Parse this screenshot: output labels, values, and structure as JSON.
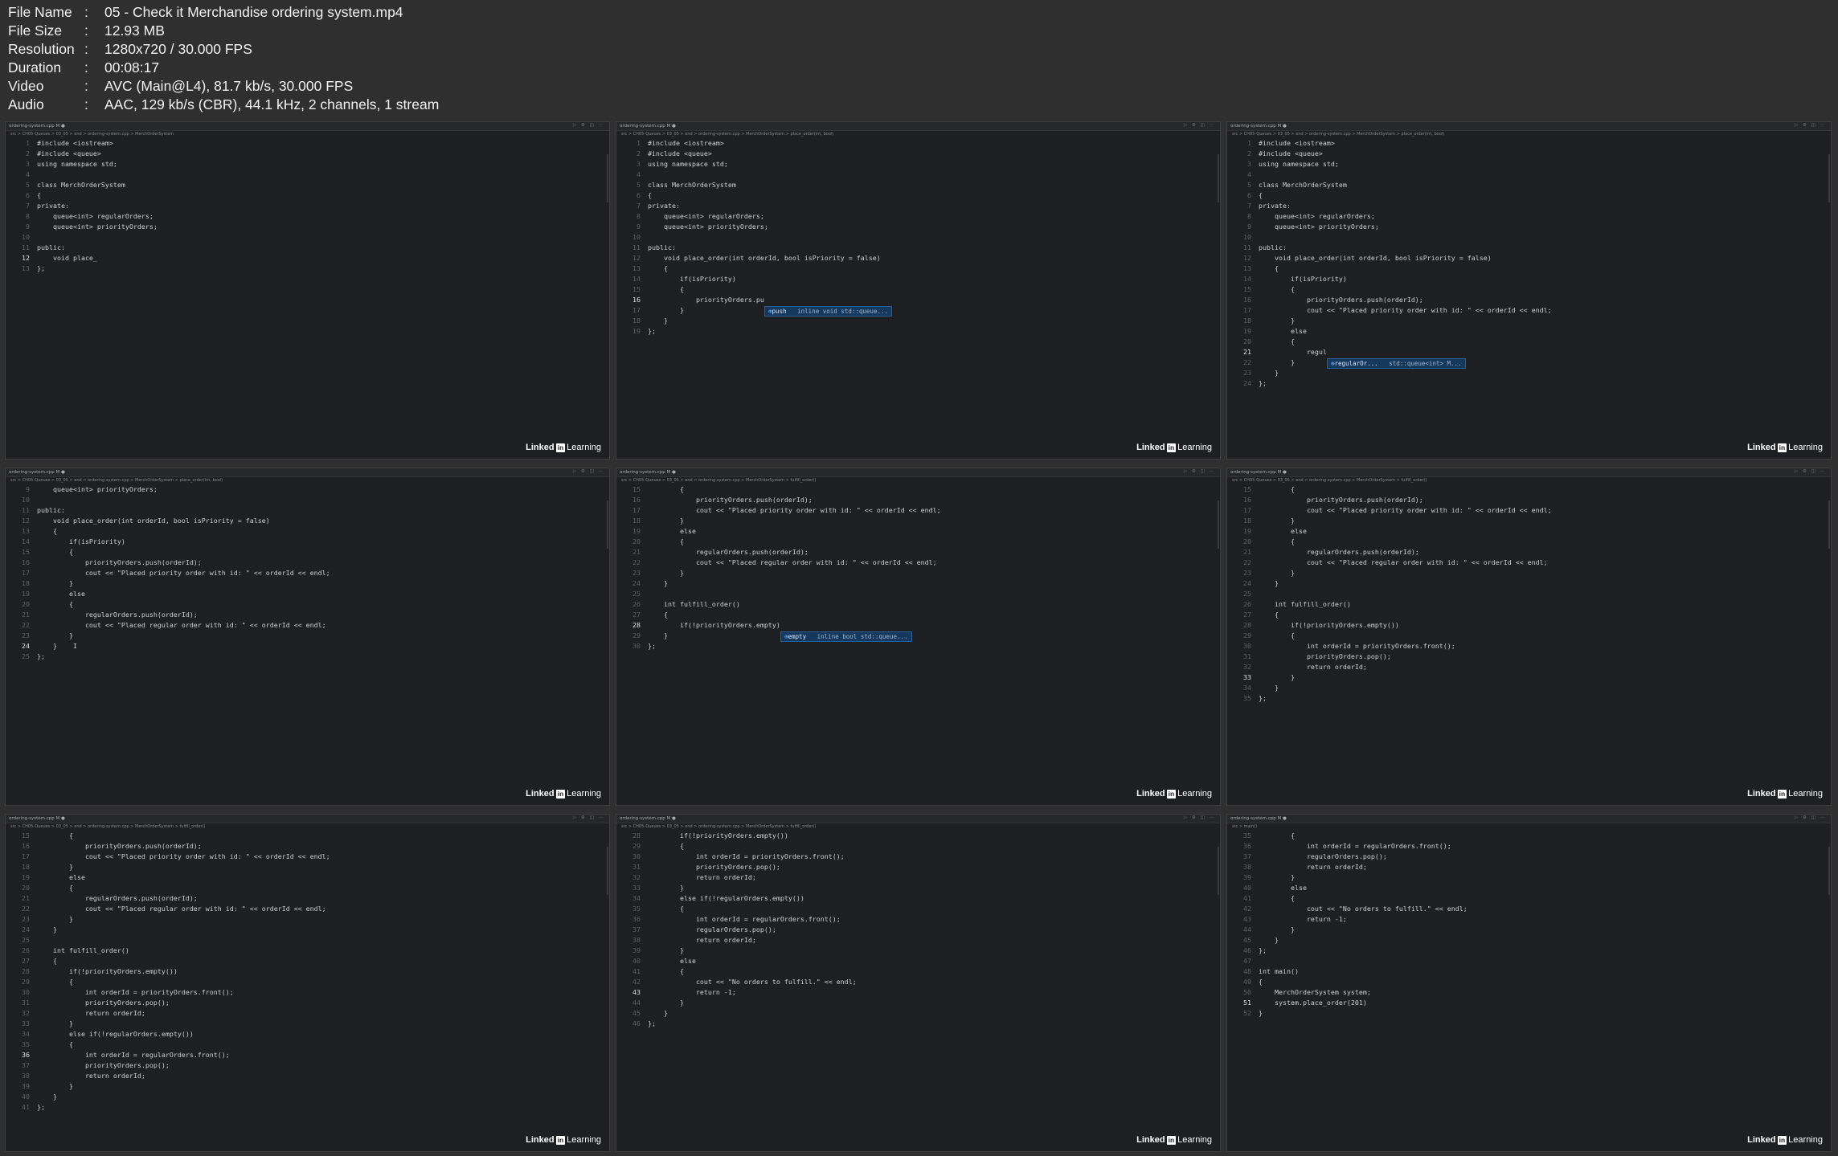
{
  "meta": [
    {
      "key": "File Name",
      "value": "05 - Check it Merchandise ordering system.mp4"
    },
    {
      "key": "File Size",
      "value": "12.93 MB"
    },
    {
      "key": "Resolution",
      "value": "1280x720 / 30.000 FPS"
    },
    {
      "key": "Duration",
      "value": "00:08:17"
    },
    {
      "key": "Video",
      "value": "AVC (Main@L4), 81.7 kb/s, 30.000 FPS"
    },
    {
      "key": "Audio",
      "value": "AAC, 129 kb/s (CBR), 44.1 kHz, 2 channels, 1 stream"
    }
  ],
  "watermark": {
    "brand": "Linked",
    "logo": "in",
    "product": "Learning"
  },
  "frames": [
    {
      "tab": "ordering-system.cpp M ●",
      "crumb": "src > CH05-Queues > 03_05 > end > ordering-system.cpp > MerchOrderSystem",
      "cursor_line": "12",
      "lines": [
        {
          "n": "1",
          "t": "#include <iostream>"
        },
        {
          "n": "2",
          "t": "#include <queue>"
        },
        {
          "n": "3",
          "t": "using namespace std;"
        },
        {
          "n": "4",
          "t": ""
        },
        {
          "n": "5",
          "t": "class MerchOrderSystem"
        },
        {
          "n": "6",
          "t": "{"
        },
        {
          "n": "7",
          "t": "private:"
        },
        {
          "n": "8",
          "t": "    queue<int> regularOrders;"
        },
        {
          "n": "9",
          "t": "    queue<int> priorityOrders;"
        },
        {
          "n": "10",
          "t": ""
        },
        {
          "n": "11",
          "t": "public:"
        },
        {
          "n": "12",
          "t": "    void place_"
        },
        {
          "n": "13",
          "t": "};"
        }
      ]
    },
    {
      "tab": "ordering-system.cpp M ●",
      "crumb": "src > CH05-Queues > 03_05 > end > ordering-system.cpp > MerchOrderSystem > place_order(int, bool)",
      "cursor_line": "16",
      "autocomplete": {
        "label": "push",
        "detail": "inline void std::queue..."
      },
      "lines": [
        {
          "n": "1",
          "t": "#include <iostream>"
        },
        {
          "n": "2",
          "t": "#include <queue>"
        },
        {
          "n": "3",
          "t": "using namespace std;"
        },
        {
          "n": "4",
          "t": ""
        },
        {
          "n": "5",
          "t": "class MerchOrderSystem"
        },
        {
          "n": "6",
          "t": "{"
        },
        {
          "n": "7",
          "t": "private:"
        },
        {
          "n": "8",
          "t": "    queue<int> regularOrders;"
        },
        {
          "n": "9",
          "t": "    queue<int> priorityOrders;"
        },
        {
          "n": "10",
          "t": ""
        },
        {
          "n": "11",
          "t": "public:"
        },
        {
          "n": "12",
          "t": "    void place_order(int orderId, bool isPriority = false)"
        },
        {
          "n": "13",
          "t": "    {"
        },
        {
          "n": "14",
          "t": "        if(isPriority)"
        },
        {
          "n": "15",
          "t": "        {"
        },
        {
          "n": "16",
          "t": "            priorityOrders.pu"
        },
        {
          "n": "17",
          "t": "        }"
        },
        {
          "n": "18",
          "t": "    }"
        },
        {
          "n": "19",
          "t": "};"
        }
      ]
    },
    {
      "tab": "ordering-system.cpp M ●",
      "crumb": "src > CH05-Queues > 03_05 > end > ordering-system.cpp > MerchOrderSystem > place_order(int, bool)",
      "cursor_line": "21",
      "autocomplete": {
        "label": "regularOr...",
        "detail": "std::queue<int> M..."
      },
      "lines": [
        {
          "n": "1",
          "t": "#include <iostream>"
        },
        {
          "n": "2",
          "t": "#include <queue>"
        },
        {
          "n": "3",
          "t": "using namespace std;"
        },
        {
          "n": "4",
          "t": ""
        },
        {
          "n": "5",
          "t": "class MerchOrderSystem"
        },
        {
          "n": "6",
          "t": "{"
        },
        {
          "n": "7",
          "t": "private:"
        },
        {
          "n": "8",
          "t": "    queue<int> regularOrders;"
        },
        {
          "n": "9",
          "t": "    queue<int> priorityOrders;"
        },
        {
          "n": "10",
          "t": ""
        },
        {
          "n": "11",
          "t": "public:"
        },
        {
          "n": "12",
          "t": "    void place_order(int orderId, bool isPriority = false)"
        },
        {
          "n": "13",
          "t": "    {"
        },
        {
          "n": "14",
          "t": "        if(isPriority)"
        },
        {
          "n": "15",
          "t": "        {"
        },
        {
          "n": "16",
          "t": "            priorityOrders.push(orderId);"
        },
        {
          "n": "17",
          "t": "            cout << \"Placed priority order with id: \" << orderId << endl;"
        },
        {
          "n": "18",
          "t": "        }"
        },
        {
          "n": "19",
          "t": "        else"
        },
        {
          "n": "20",
          "t": "        {"
        },
        {
          "n": "21",
          "t": "            regul"
        },
        {
          "n": "22",
          "t": "        }"
        },
        {
          "n": "23",
          "t": "    }"
        },
        {
          "n": "24",
          "t": "};"
        }
      ]
    },
    {
      "tab": "ordering-system.cpp M ●",
      "crumb": "src > CH05-Queues > 03_05 > end > ordering-system.cpp > MerchOrderSystem > place_order(int, bool)",
      "cursor_line": "24",
      "lines": [
        {
          "n": "9",
          "t": "    queue<int> priorityOrders;"
        },
        {
          "n": "10",
          "t": ""
        },
        {
          "n": "11",
          "t": "public:"
        },
        {
          "n": "12",
          "t": "    void place_order(int orderId, bool isPriority = false)"
        },
        {
          "n": "13",
          "t": "    {"
        },
        {
          "n": "14",
          "t": "        if(isPriority)"
        },
        {
          "n": "15",
          "t": "        {"
        },
        {
          "n": "16",
          "t": "            priorityOrders.push(orderId);"
        },
        {
          "n": "17",
          "t": "            cout << \"Placed priority order with id: \" << orderId << endl;"
        },
        {
          "n": "18",
          "t": "        }"
        },
        {
          "n": "19",
          "t": "        else"
        },
        {
          "n": "20",
          "t": "        {"
        },
        {
          "n": "21",
          "t": "            regularOrders.push(orderId);"
        },
        {
          "n": "22",
          "t": "            cout << \"Placed regular order with id: \" << orderId << endl;"
        },
        {
          "n": "23",
          "t": "        }"
        },
        {
          "n": "24",
          "t": "    }    I"
        },
        {
          "n": "25",
          "t": "};"
        }
      ]
    },
    {
      "tab": "ordering-system.cpp M ●",
      "crumb": "src > CH05-Queues > 03_05 > end > ordering-system.cpp > MerchOrderSystem > fulfill_order()",
      "cursor_line": "28",
      "autocomplete": {
        "label": "empty",
        "detail": "inline bool std::queue..."
      },
      "lines": [
        {
          "n": "15",
          "t": "        {"
        },
        {
          "n": "16",
          "t": "            priorityOrders.push(orderId);"
        },
        {
          "n": "17",
          "t": "            cout << \"Placed priority order with id: \" << orderId << endl;"
        },
        {
          "n": "18",
          "t": "        }"
        },
        {
          "n": "19",
          "t": "        else"
        },
        {
          "n": "20",
          "t": "        {"
        },
        {
          "n": "21",
          "t": "            regularOrders.push(orderId);"
        },
        {
          "n": "22",
          "t": "            cout << \"Placed regular order with id: \" << orderId << endl;"
        },
        {
          "n": "23",
          "t": "        }"
        },
        {
          "n": "24",
          "t": "    }"
        },
        {
          "n": "25",
          "t": ""
        },
        {
          "n": "26",
          "t": "    int fulfill_order()"
        },
        {
          "n": "27",
          "t": "    {"
        },
        {
          "n": "28",
          "t": "        if(!priorityOrders.empty)"
        },
        {
          "n": "29",
          "t": "    }"
        },
        {
          "n": "30",
          "t": "};"
        }
      ]
    },
    {
      "tab": "ordering-system.cpp M ●",
      "crumb": "src > CH05-Queues > 03_05 > end > ordering-system.cpp > MerchOrderSystem > fulfill_order()",
      "cursor_line": "33",
      "lines": [
        {
          "n": "15",
          "t": "        {"
        },
        {
          "n": "16",
          "t": "            priorityOrders.push(orderId);"
        },
        {
          "n": "17",
          "t": "            cout << \"Placed priority order with id: \" << orderId << endl;"
        },
        {
          "n": "18",
          "t": "        }"
        },
        {
          "n": "19",
          "t": "        else"
        },
        {
          "n": "20",
          "t": "        {"
        },
        {
          "n": "21",
          "t": "            regularOrders.push(orderId);"
        },
        {
          "n": "22",
          "t": "            cout << \"Placed regular order with id: \" << orderId << endl;"
        },
        {
          "n": "23",
          "t": "        }"
        },
        {
          "n": "24",
          "t": "    }"
        },
        {
          "n": "25",
          "t": ""
        },
        {
          "n": "26",
          "t": "    int fulfill_order()"
        },
        {
          "n": "27",
          "t": "    {"
        },
        {
          "n": "28",
          "t": "        if(!priorityOrders.empty())"
        },
        {
          "n": "29",
          "t": "        {"
        },
        {
          "n": "30",
          "t": "            int orderId = priorityOrders.front();"
        },
        {
          "n": "31",
          "t": "            priorityOrders.pop();"
        },
        {
          "n": "32",
          "t": "            return orderId;"
        },
        {
          "n": "33",
          "t": "        }"
        },
        {
          "n": "34",
          "t": "    }"
        },
        {
          "n": "35",
          "t": "};"
        }
      ]
    },
    {
      "tab": "ordering-system.cpp M ●",
      "crumb": "src > CH05-Queues > 03_05 > end > ordering-system.cpp > MerchOrderSystem > fulfill_order()",
      "cursor_line": "36",
      "lines": [
        {
          "n": "15",
          "t": "        {"
        },
        {
          "n": "16",
          "t": "            priorityOrders.push(orderId);"
        },
        {
          "n": "17",
          "t": "            cout << \"Placed priority order with id: \" << orderId << endl;"
        },
        {
          "n": "18",
          "t": "        }"
        },
        {
          "n": "19",
          "t": "        else"
        },
        {
          "n": "20",
          "t": "        {"
        },
        {
          "n": "21",
          "t": "            regularOrders.push(orderId);"
        },
        {
          "n": "22",
          "t": "            cout << \"Placed regular order with id: \" << orderId << endl;"
        },
        {
          "n": "23",
          "t": "        }"
        },
        {
          "n": "24",
          "t": "    }"
        },
        {
          "n": "25",
          "t": ""
        },
        {
          "n": "26",
          "t": "    int fulfill_order()"
        },
        {
          "n": "27",
          "t": "    {"
        },
        {
          "n": "28",
          "t": "        if(!priorityOrders.empty())"
        },
        {
          "n": "29",
          "t": "        {"
        },
        {
          "n": "30",
          "t": "            int orderId = priorityOrders.front();"
        },
        {
          "n": "31",
          "t": "            priorityOrders.pop();"
        },
        {
          "n": "32",
          "t": "            return orderId;"
        },
        {
          "n": "33",
          "t": "        }"
        },
        {
          "n": "34",
          "t": "        else if(!regularOrders.empty())"
        },
        {
          "n": "35",
          "t": "        {"
        },
        {
          "n": "36",
          "t": "            int orderId = regularOrders.front();"
        },
        {
          "n": "37",
          "t": "            priorityOrders.pop();"
        },
        {
          "n": "38",
          "t": "            return orderId;"
        },
        {
          "n": "39",
          "t": "        }"
        },
        {
          "n": "40",
          "t": "    }"
        },
        {
          "n": "41",
          "t": "};"
        }
      ]
    },
    {
      "tab": "ordering-system.cpp M ●",
      "crumb": "src > CH05-Queues > 03_05 > end > ordering-system.cpp > MerchOrderSystem > fulfill_order()",
      "cursor_line": "43",
      "lines": [
        {
          "n": "28",
          "t": "        if(!priorityOrders.empty())"
        },
        {
          "n": "29",
          "t": "        {"
        },
        {
          "n": "30",
          "t": "            int orderId = priorityOrders.front();"
        },
        {
          "n": "31",
          "t": "            priorityOrders.pop();"
        },
        {
          "n": "32",
          "t": "            return orderId;"
        },
        {
          "n": "33",
          "t": "        }"
        },
        {
          "n": "34",
          "t": "        else if(!regularOrders.empty())"
        },
        {
          "n": "35",
          "t": "        {"
        },
        {
          "n": "36",
          "t": "            int orderId = regularOrders.front();"
        },
        {
          "n": "37",
          "t": "            regularOrders.pop();"
        },
        {
          "n": "38",
          "t": "            return orderId;"
        },
        {
          "n": "39",
          "t": "        }"
        },
        {
          "n": "40",
          "t": "        else"
        },
        {
          "n": "41",
          "t": "        {"
        },
        {
          "n": "42",
          "t": "            cout << \"No orders to fulfill.\" << endl;"
        },
        {
          "n": "43",
          "t": "            return -1;"
        },
        {
          "n": "44",
          "t": "        }"
        },
        {
          "n": "45",
          "t": "    }"
        },
        {
          "n": "46",
          "t": "};"
        }
      ]
    },
    {
      "tab": "ordering-system.cpp M ●",
      "crumb": "src > main()",
      "cursor_line": "51",
      "lines": [
        {
          "n": "35",
          "t": "        {"
        },
        {
          "n": "36",
          "t": "            int orderId = regularOrders.front();"
        },
        {
          "n": "37",
          "t": "            regularOrders.pop();"
        },
        {
          "n": "38",
          "t": "            return orderId;"
        },
        {
          "n": "39",
          "t": "        }"
        },
        {
          "n": "40",
          "t": "        else"
        },
        {
          "n": "41",
          "t": "        {"
        },
        {
          "n": "42",
          "t": "            cout << \"No orders to fulfill.\" << endl;"
        },
        {
          "n": "43",
          "t": "            return -1;"
        },
        {
          "n": "44",
          "t": "        }"
        },
        {
          "n": "45",
          "t": "    }"
        },
        {
          "n": "46",
          "t": "};"
        },
        {
          "n": "47",
          "t": ""
        },
        {
          "n": "48",
          "t": "int main()"
        },
        {
          "n": "49",
          "t": "{"
        },
        {
          "n": "50",
          "t": "    MerchOrderSystem system;"
        },
        {
          "n": "51",
          "t": "    system.place_order(201)"
        },
        {
          "n": "52",
          "t": "}"
        }
      ]
    }
  ]
}
